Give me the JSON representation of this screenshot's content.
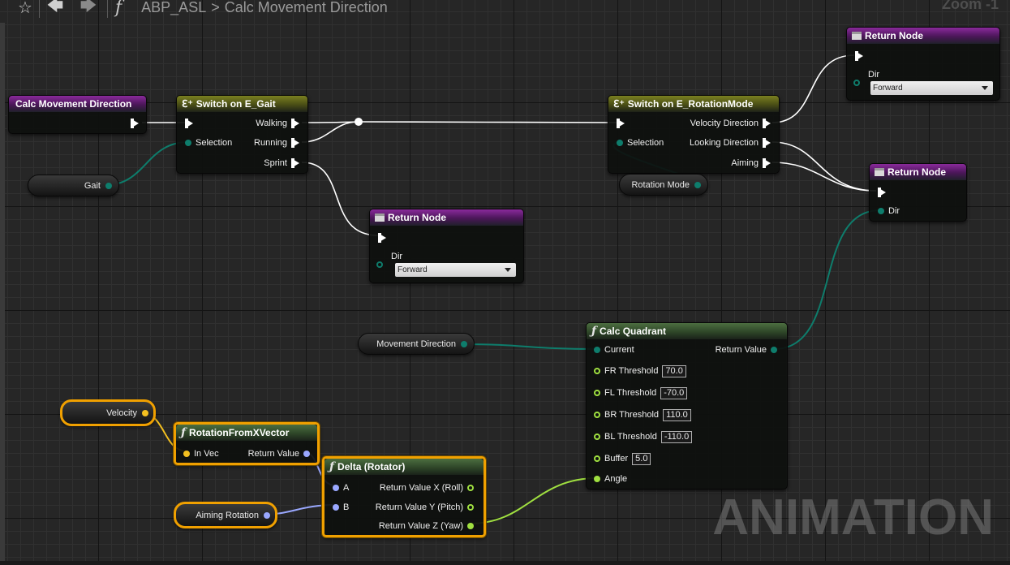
{
  "toolbar": {
    "favorite_icon": "star-icon",
    "back_icon": "arrow-left-icon",
    "forward_icon": "arrow-right-icon",
    "function_icon": "function-icon",
    "function_glyph": "f",
    "breadcrumb": [
      "ABP_ASL",
      "Calc Movement Direction"
    ],
    "breadcrumb_sep": ">",
    "zoom": "Zoom -1"
  },
  "nodes": {
    "entry": {
      "title": "Calc Movement Direction"
    },
    "switch_gait": {
      "title": "Switch on E_Gait",
      "selection": "Selection",
      "walking": "Walking",
      "running": "Running",
      "sprint": "Sprint"
    },
    "switch_rot": {
      "title": "Switch on E_RotationMode",
      "selection": "Selection",
      "velocity": "Velocity Direction",
      "looking": "Looking Direction",
      "aiming": "Aiming"
    },
    "return_top": {
      "title": "Return Node",
      "dir": "Dir",
      "value": "Forward"
    },
    "return_mid": {
      "title": "Return Node",
      "dir": "Dir",
      "value": "Forward"
    },
    "return_right": {
      "title": "Return Node",
      "dir": "Dir"
    },
    "calc_quadrant": {
      "title": "Calc Quadrant",
      "current": "Current",
      "return_value": "Return Value",
      "params": [
        {
          "label": "FR Threshold",
          "value": "70.0"
        },
        {
          "label": "FL Threshold",
          "value": "-70.0"
        },
        {
          "label": "BR Threshold",
          "value": "110.0"
        },
        {
          "label": "BL Threshold",
          "value": "-110.0"
        },
        {
          "label": "Buffer",
          "value": "5.0"
        }
      ],
      "angle": "Angle"
    },
    "rot_from_x": {
      "title": "RotationFromXVector",
      "in_vec": "In Vec",
      "return_value": "Return Value"
    },
    "delta": {
      "title": "Delta (Rotator)",
      "a": "A",
      "b": "B",
      "rx": "Return Value X (Roll)",
      "ry": "Return Value Y (Pitch)",
      "rz": "Return Value Z (Yaw)"
    }
  },
  "variables": {
    "gait": "Gait",
    "rotation_mode": "Rotation Mode",
    "movement_direction": "Movement Direction",
    "velocity": "Velocity",
    "aiming_rotation": "Aiming Rotation"
  },
  "colors": {
    "exec": "#ffffff",
    "enum_pin": "#0e7d6c",
    "vector_pin": "#f4c020",
    "rotator_pin": "#9aa8ff",
    "float_pin": "#a0e040",
    "selection": "#f0a000"
  },
  "watermark": "ANIMATION"
}
